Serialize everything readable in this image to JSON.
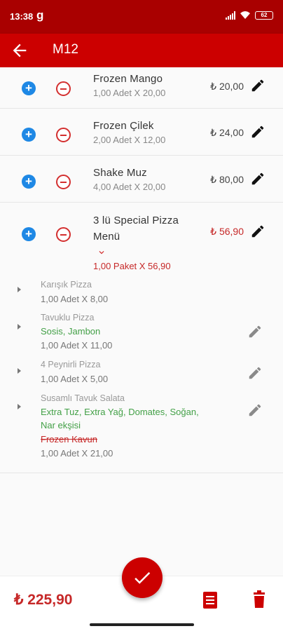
{
  "status_bar": {
    "time": "13:38",
    "notification": "g",
    "battery": "62"
  },
  "header": {
    "title": "M12"
  },
  "items": [
    {
      "name": "Frozen  Mango",
      "qty": "1,00 Adet X 20,00",
      "price": "₺ 20,00"
    },
    {
      "name": "Frozen  Çilek",
      "qty": "2,00 Adet X 12,00",
      "price": "₺ 24,00"
    },
    {
      "name": "Shake Muz",
      "qty": "4,00 Adet X 20,00",
      "price": "₺ 80,00"
    }
  ],
  "menu": {
    "name_line1": "3 lü Special Pizza",
    "name_line2": "Menü",
    "qty": "1,00 Paket X 56,90",
    "price": "₺ 56,90",
    "sub_items": [
      {
        "name": "Karışık Pizza",
        "qty": "1,00 Adet X 8,00"
      },
      {
        "name": "Tavuklu Pizza",
        "modifier": "Sosis, Jambon",
        "qty": "1,00 Adet X 11,00"
      },
      {
        "name": "4 Peynirli Pizza",
        "qty": "1,00 Adet X 5,00"
      },
      {
        "name": "Susamlı Tavuk Salata",
        "modifier_line1": "Extra Tuz, Extra Yağ, Domates, Soğan,",
        "modifier_line2": "Nar ekşisi",
        "removed": "Frozen  Kavun",
        "qty": "1,00 Adet X 21,00"
      }
    ]
  },
  "footer": {
    "total": "₺ 225,90"
  },
  "colors": {
    "primary": "#cc0000",
    "status_bar": "#a90000",
    "plus": "#1e88e5",
    "modifier": "#43a047"
  }
}
